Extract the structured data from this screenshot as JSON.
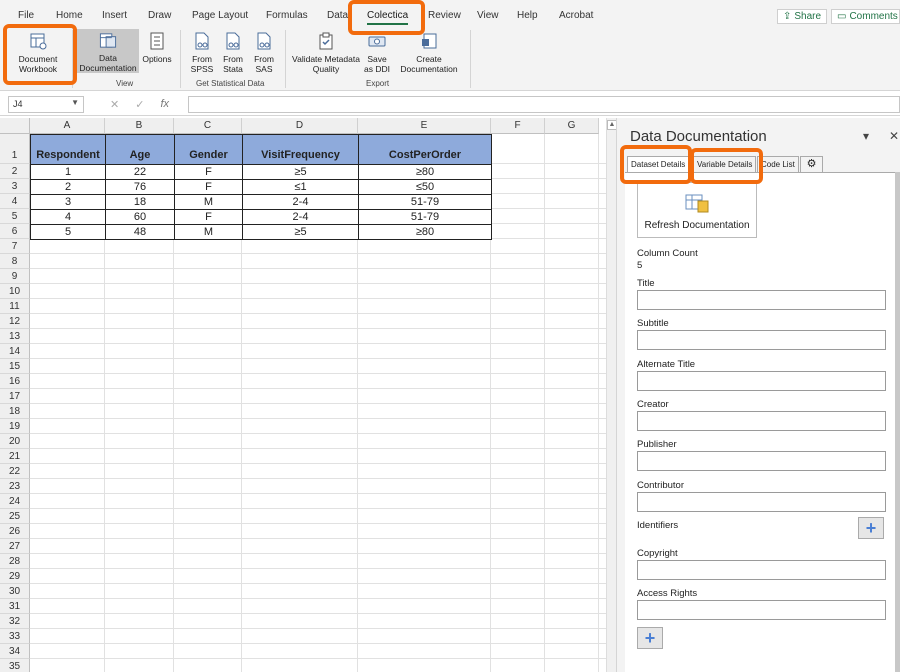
{
  "ribbon_tabs": [
    "File",
    "Home",
    "Insert",
    "Draw",
    "Page Layout",
    "Formulas",
    "Data",
    "Colectica",
    "Review",
    "View",
    "Help",
    "Acrobat"
  ],
  "share_label": "Share",
  "comments_label": "Comments",
  "ribbon": {
    "document_workbook": "Document Workbook",
    "data_documentation": "Data Documentation",
    "options": "Options",
    "from_spss": "From SPSS",
    "from_stata": "From Stata",
    "from_sas": "From SAS",
    "validate": "Validate Metadata Quality",
    "save_ddi": "Save as DDI",
    "create_doc": "Create Documentation",
    "group_view": "View",
    "group_get": "Get Statistical Data",
    "group_export": "Export"
  },
  "formula_bar": {
    "name_box": "J4",
    "formula": ""
  },
  "grid": {
    "columns": [
      "A",
      "B",
      "C",
      "D",
      "E",
      "F",
      "G"
    ],
    "rows": [
      "1",
      "2",
      "3",
      "4",
      "5",
      "6",
      "7",
      "8",
      "9",
      "10",
      "11",
      "12",
      "13",
      "14",
      "15",
      "16",
      "17",
      "18",
      "19",
      "20",
      "21",
      "22",
      "23",
      "24",
      "25",
      "26",
      "27",
      "28",
      "29",
      "30",
      "31",
      "32",
      "33",
      "34",
      "35"
    ],
    "headers": [
      "Respondent",
      "Age",
      "Gender",
      "VisitFrequency",
      "CostPerOrder"
    ],
    "data": [
      [
        "1",
        "22",
        "F",
        "≥5",
        "≥80"
      ],
      [
        "2",
        "76",
        "F",
        "≤1",
        "≤50"
      ],
      [
        "3",
        "18",
        "M",
        "2-4",
        "51-79"
      ],
      [
        "4",
        "60",
        "F",
        "2-4",
        "51-79"
      ],
      [
        "5",
        "48",
        "M",
        "≥5",
        "≥80"
      ]
    ]
  },
  "pane": {
    "title": "Data Documentation",
    "tabs": [
      "Dataset Details",
      "Variable Details",
      "Code List"
    ],
    "refresh_label": "Refresh Documentation",
    "column_count_label": "Column Count",
    "column_count_value": "5",
    "fields": [
      "Title",
      "Subtitle",
      "Alternate Title",
      "Creator",
      "Publisher",
      "Contributor"
    ],
    "identifiers_label": "Identifiers",
    "copyright_label": "Copyright",
    "access_rights_label": "Access Rights"
  },
  "colors": {
    "highlight": "#f26b0d",
    "header_fill": "#8eaadb",
    "excel_green": "#217346"
  }
}
